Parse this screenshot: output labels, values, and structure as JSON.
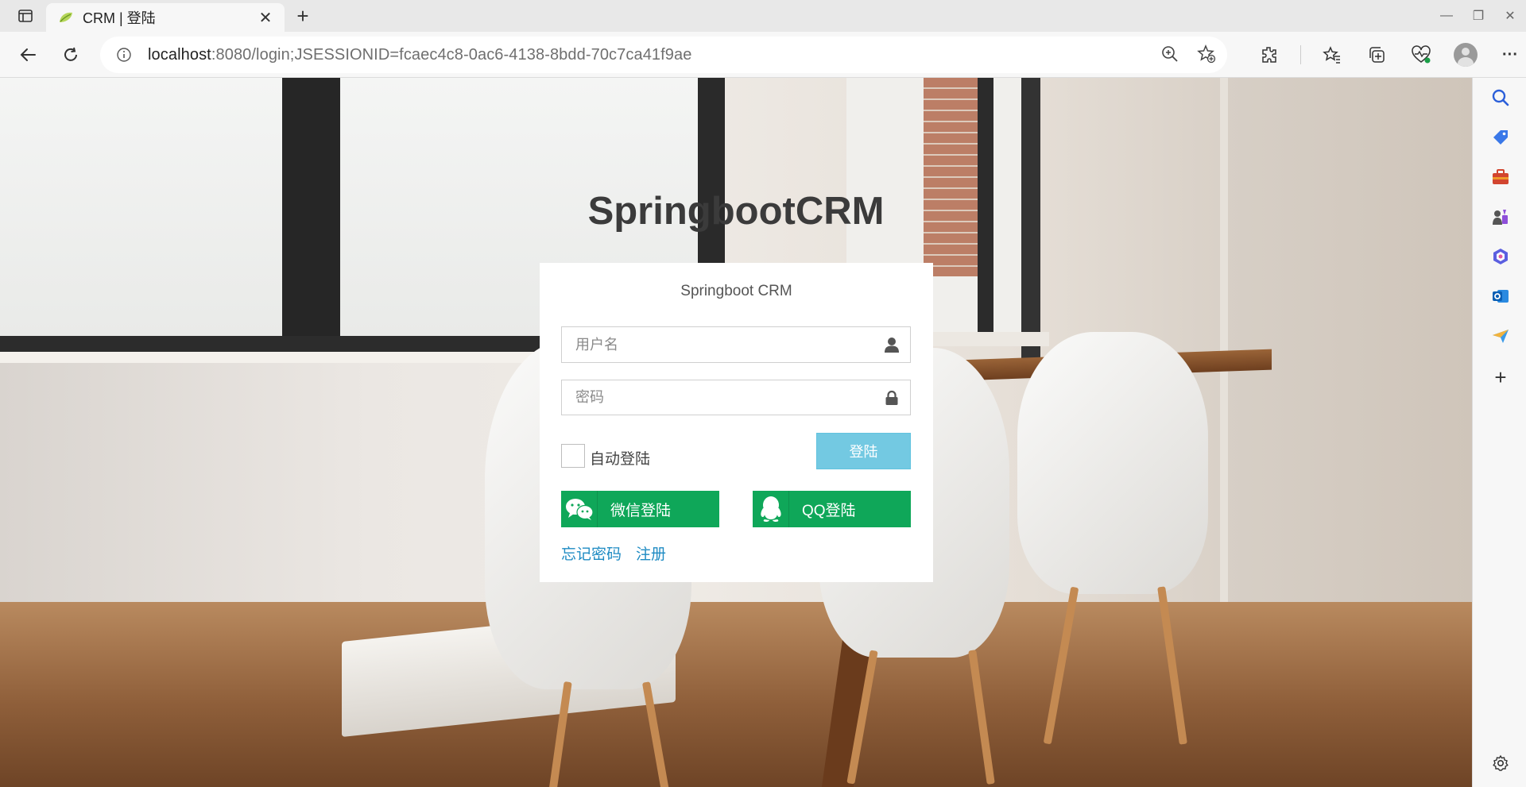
{
  "browser": {
    "tab": {
      "title": "CRM | 登陆",
      "close": "✕"
    },
    "new_tab": "+",
    "window_controls": {
      "minimize": "—",
      "maximize": "❐",
      "close": "✕"
    },
    "address": {
      "host": "localhost",
      "rest": ":8080/login;JSESSIONID=fcaec4c8-0ac6-4138-8bdd-70c7ca41f9ae"
    },
    "more": "···",
    "sidebar_add": "+"
  },
  "page": {
    "site_title": "SpringbootCRM",
    "card_title": "Springboot CRM",
    "username_placeholder": "用户名",
    "password_placeholder": "密码",
    "remember_label": "自动登陆",
    "login_label": "登陆",
    "wechat_label": "微信登陆",
    "qq_label": "QQ登陆",
    "forgot_label": "忘记密码",
    "register_label": "注册"
  },
  "colors": {
    "login_button": "#5bc0de",
    "social_button": "#0fa759",
    "link": "#1e8bc3"
  },
  "icons": {
    "username": "user-icon",
    "password": "lock-icon",
    "wechat": "wechat-icon",
    "qq": "qq-icon"
  }
}
